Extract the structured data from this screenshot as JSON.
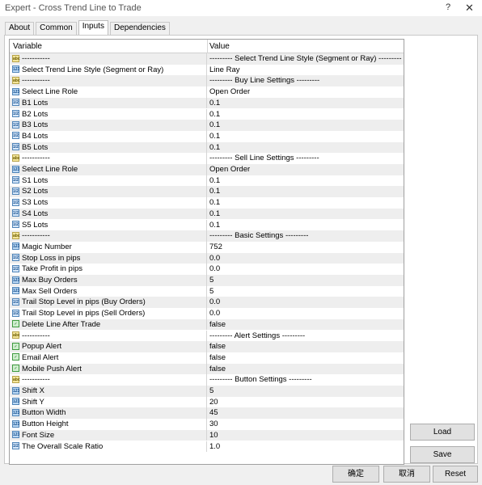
{
  "window": {
    "title": "Expert - Cross Trend Line to Trade",
    "help": "?",
    "close": "✕"
  },
  "tabs": [
    {
      "label": "About"
    },
    {
      "label": "Common"
    },
    {
      "label": "Inputs"
    },
    {
      "label": "Dependencies"
    }
  ],
  "grid": {
    "headers": {
      "variable": "Variable",
      "value": "Value"
    },
    "rows": [
      {
        "icon": "abc",
        "type": "str",
        "name": "-----------",
        "value": "--------- Select Trend Line Style (Segment or Ray) ---------"
      },
      {
        "icon": "123",
        "type": "enum",
        "name": "Select Trend Line Style (Segment or Ray)",
        "value": "Line Ray"
      },
      {
        "icon": "abc",
        "type": "str",
        "name": "-----------",
        "value": "--------- Buy Line Settings ---------"
      },
      {
        "icon": "123",
        "type": "enum",
        "name": "Select Line Role",
        "value": "Open Order"
      },
      {
        "icon": "1/2",
        "type": "dbl",
        "name": "B1 Lots",
        "value": "0.1"
      },
      {
        "icon": "1/2",
        "type": "dbl",
        "name": "B2 Lots",
        "value": "0.1"
      },
      {
        "icon": "1/2",
        "type": "dbl",
        "name": "B3 Lots",
        "value": "0.1"
      },
      {
        "icon": "1/2",
        "type": "dbl",
        "name": "B4 Lots",
        "value": "0.1"
      },
      {
        "icon": "1/2",
        "type": "dbl",
        "name": "B5 Lots",
        "value": "0.1"
      },
      {
        "icon": "abc",
        "type": "str",
        "name": "-----------",
        "value": "--------- Sell Line Settings ---------"
      },
      {
        "icon": "123",
        "type": "enum",
        "name": "Select Line Role",
        "value": "Open Order"
      },
      {
        "icon": "1/2",
        "type": "dbl",
        "name": "S1 Lots",
        "value": "0.1"
      },
      {
        "icon": "1/2",
        "type": "dbl",
        "name": "S2 Lots",
        "value": "0.1"
      },
      {
        "icon": "1/2",
        "type": "dbl",
        "name": "S3 Lots",
        "value": "0.1"
      },
      {
        "icon": "1/2",
        "type": "dbl",
        "name": "S4 Lots",
        "value": "0.1"
      },
      {
        "icon": "1/2",
        "type": "dbl",
        "name": "S5 Lots",
        "value": "0.1"
      },
      {
        "icon": "abc",
        "type": "str",
        "name": "-----------",
        "value": "--------- Basic Settings ---------"
      },
      {
        "icon": "123",
        "type": "enum",
        "name": "Magic Number",
        "value": "752"
      },
      {
        "icon": "1/2",
        "type": "dbl",
        "name": "Stop Loss in pips",
        "value": "0.0"
      },
      {
        "icon": "1/2",
        "type": "dbl",
        "name": "Take Profit in pips",
        "value": "0.0"
      },
      {
        "icon": "123",
        "type": "enum",
        "name": "Max Buy Orders",
        "value": "5"
      },
      {
        "icon": "123",
        "type": "enum",
        "name": "Max Sell Orders",
        "value": "5"
      },
      {
        "icon": "1/2",
        "type": "dbl",
        "name": "Trail Stop Level in pips (Buy Orders)",
        "value": "0.0"
      },
      {
        "icon": "1/2",
        "type": "dbl",
        "name": "Trail Stop Level in pips (Sell Orders)",
        "value": "0.0"
      },
      {
        "icon": "✓",
        "type": "bool",
        "name": "Delete Line After Trade",
        "value": "false"
      },
      {
        "icon": "abc",
        "type": "str",
        "name": "-----------",
        "value": "--------- Alert Settings ---------"
      },
      {
        "icon": "✓",
        "type": "bool",
        "name": "Popup Alert",
        "value": "false"
      },
      {
        "icon": "✓",
        "type": "bool",
        "name": "Email Alert",
        "value": "false"
      },
      {
        "icon": "✓",
        "type": "bool",
        "name": "Mobile Push Alert",
        "value": "false"
      },
      {
        "icon": "abc",
        "type": "str",
        "name": "-----------",
        "value": "--------- Button Settings ---------"
      },
      {
        "icon": "123",
        "type": "enum",
        "name": "Shift X",
        "value": "5"
      },
      {
        "icon": "123",
        "type": "enum",
        "name": "Shift Y",
        "value": "20"
      },
      {
        "icon": "123",
        "type": "enum",
        "name": "Button Width",
        "value": "45"
      },
      {
        "icon": "123",
        "type": "enum",
        "name": "Button Height",
        "value": "30"
      },
      {
        "icon": "123",
        "type": "enum",
        "name": "Font Size",
        "value": "10"
      },
      {
        "icon": "1/2",
        "type": "dbl",
        "name": "The Overall Scale Ratio",
        "value": "1.0"
      }
    ]
  },
  "buttons": {
    "load": "Load",
    "save": "Save",
    "ok": "确定",
    "cancel": "取消",
    "reset": "Reset"
  }
}
